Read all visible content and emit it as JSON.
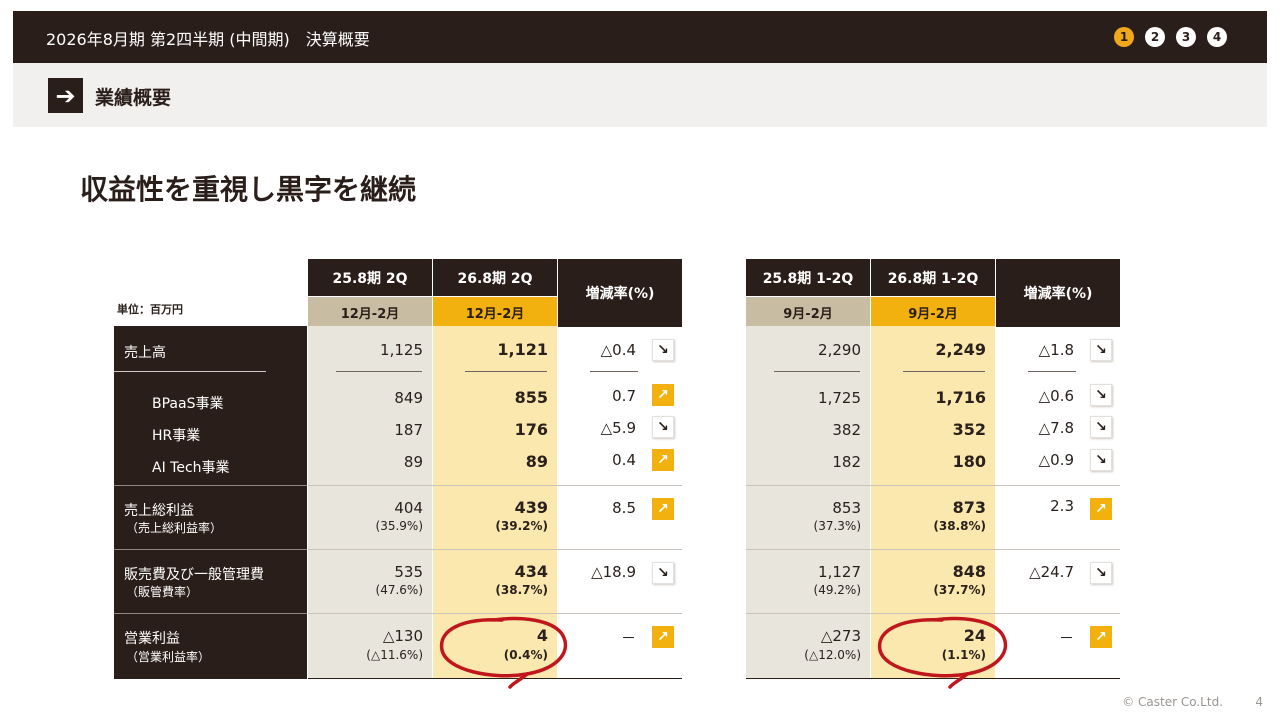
{
  "header": {
    "title": "2026年8月期 第2四半期 (中間期)　決算概要",
    "pages": [
      "1",
      "2",
      "3",
      "4"
    ],
    "active_page": "1"
  },
  "section": {
    "icon": "arrow-right-icon",
    "label": "業績概要"
  },
  "headline": "収益性を重視し黒字を継続",
  "unit_label": "単位：百万円",
  "rows": {
    "sales": "売上高",
    "bpaas": "BPaaS事業",
    "hr": "HR事業",
    "aitech": "AI Tech事業",
    "gross": "売上総利益",
    "gross_rate": "（売上総利益率）",
    "sga": "販売費及び一般管理費",
    "sga_rate": "（販管費率）",
    "op": "営業利益",
    "op_rate": "（営業利益率）"
  },
  "quarter": {
    "prev_header": "25.8期 2Q",
    "prev_period": "12月-2月",
    "cur_header": "26.8期 2Q",
    "cur_period": "12月-2月",
    "rate_header": "増減率(%)",
    "prev": {
      "sales": "1,125",
      "bpaas": "849",
      "hr": "187",
      "aitech": "89",
      "gross": "404",
      "gross_rate": "(35.9%)",
      "sga": "535",
      "sga_rate": "(47.6%)",
      "op": "△130",
      "op_rate": "(△11.6%)"
    },
    "cur": {
      "sales": "1,121",
      "bpaas": "855",
      "hr": "176",
      "aitech": "89",
      "gross": "439",
      "gross_rate": "(39.2%)",
      "sga": "434",
      "sga_rate": "(38.7%)",
      "op": "4",
      "op_rate": "(0.4%)"
    },
    "rate": {
      "sales": "△0.4",
      "bpaas": "0.7",
      "hr": "△5.9",
      "aitech": "0.4",
      "gross": "8.5",
      "sga": "△18.9",
      "op": "－"
    }
  },
  "halfyear": {
    "prev_header": "25.8期 1-2Q",
    "prev_period": "9月-2月",
    "cur_header": "26.8期 1-2Q",
    "cur_period": "9月-2月",
    "rate_header": "増減率(%)",
    "prev": {
      "sales": "2,290",
      "bpaas": "1,725",
      "hr": "382",
      "aitech": "182",
      "gross": "853",
      "gross_rate": "(37.3%)",
      "sga": "1,127",
      "sga_rate": "(49.2%)",
      "op": "△273",
      "op_rate": "(△12.0%)"
    },
    "cur": {
      "sales": "2,249",
      "bpaas": "1,716",
      "hr": "352",
      "aitech": "180",
      "gross": "873",
      "gross_rate": "(38.8%)",
      "sga": "848",
      "sga_rate": "(37.7%)",
      "op": "24",
      "op_rate": "(1.1%)"
    },
    "rate": {
      "sales": "△1.8",
      "bpaas": "△0.6",
      "hr": "△7.8",
      "aitech": "△0.9",
      "gross": "2.3",
      "sga": "△24.7",
      "op": "－"
    }
  },
  "icons": {
    "up": "arrow-up-right-icon",
    "down": "arrow-down-right-icon"
  },
  "colors": {
    "dark": "#2a1e1a",
    "accent": "#f2b10f",
    "circle": "#c0161d"
  },
  "footer": {
    "copyright": "© Caster Co.Ltd.",
    "page_number": "4"
  }
}
